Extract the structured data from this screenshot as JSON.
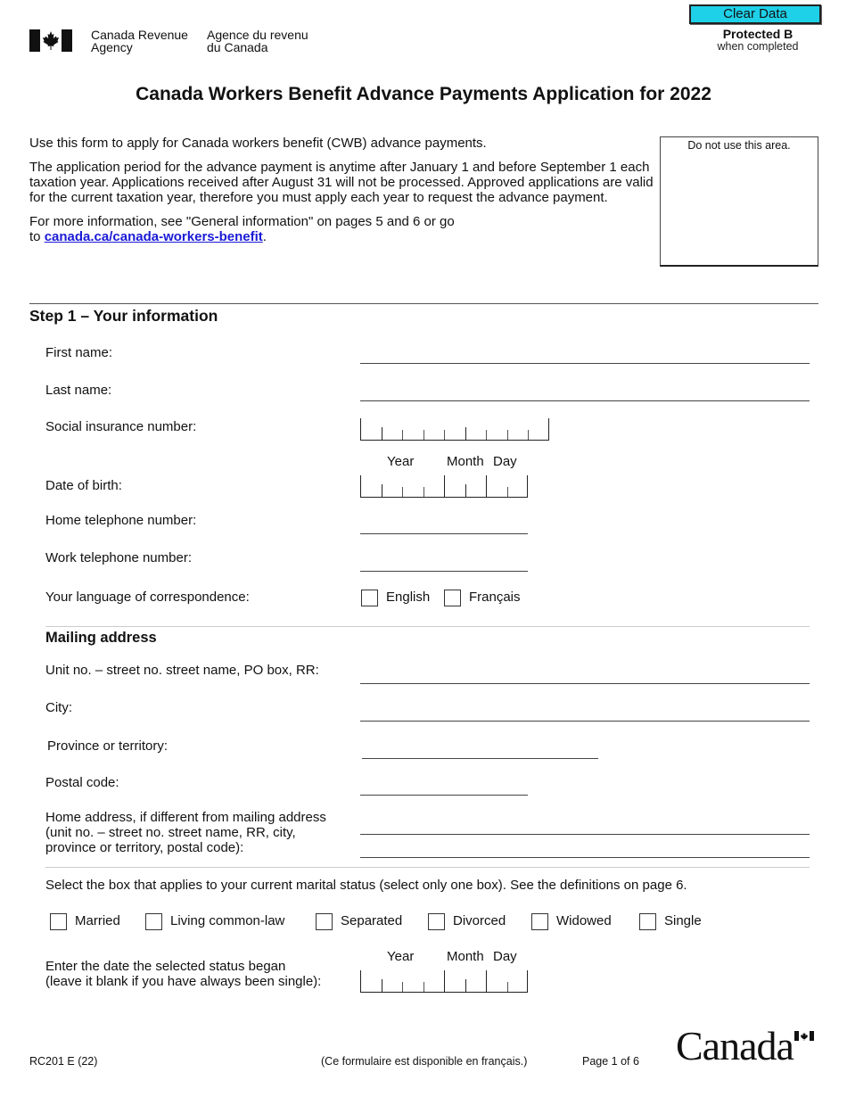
{
  "header": {
    "agency_en_line1": "Canada Revenue",
    "agency_en_line2": "Agency",
    "agency_fr_line1": "Agence du revenu",
    "agency_fr_line2": "du Canada",
    "clear_button": "Clear Data",
    "protected": "Protected B",
    "protected_sub": "when completed",
    "title": "Canada Workers Benefit Advance Payments Application for 2022",
    "accent_color": "#1ed0e8"
  },
  "intro": {
    "p1": "Use this form to apply for Canada workers benefit (CWB) advance payments.",
    "p2": "The application period for the advance payment is anytime after January 1 and before September 1 each taxation year. Applications received after August 31 will not be processed. Approved applications are valid for the current taxation year, therefore you must apply each year to request the advance payment.",
    "p3_prefix": "For more information, see \"General information\" on pages 5 and 6 or go",
    "p3_to": "to ",
    "link": "canada.ca/canada-workers-benefit",
    "p3_suffix": ".",
    "do_not_use": "Do not use this area."
  },
  "step1": {
    "title": "Step 1 – Your information",
    "first_name": "First name:",
    "last_name": "Last name:",
    "sin": "Social insurance number:",
    "dob": "Date of birth:",
    "date_year": "Year",
    "date_month": "Month",
    "date_day": "Day",
    "home_phone": "Home telephone number:",
    "work_phone": "Work telephone number:",
    "language": "Your language of correspondence:",
    "lang_options": [
      "English",
      "Français"
    ]
  },
  "mailing": {
    "title": "Mailing address",
    "street": "Unit no. – street no. street name, PO box, RR:",
    "city": "City:",
    "province": "Province or territory:",
    "postal": "Postal code:",
    "home_line1": "Home address, if different from mailing address",
    "home_line2": "(unit no. – street no. street name, RR, city,",
    "home_line3": "province or territory, postal code):"
  },
  "marital": {
    "instruction": "Select the box that applies to your current marital status (select only one box). See the definitions on page 6.",
    "options": [
      "Married",
      "Living common-law",
      "Separated",
      "Divorced",
      "Widowed",
      "Single"
    ],
    "date_line1": "Enter the date the selected status began",
    "date_line2": "(leave it blank if you have always been single):"
  },
  "footer": {
    "form_code": "RC201 E (22)",
    "french_note": "(Ce formulaire est disponible en français.)",
    "page": "Page 1 of 6",
    "wordmark": "Canada"
  }
}
